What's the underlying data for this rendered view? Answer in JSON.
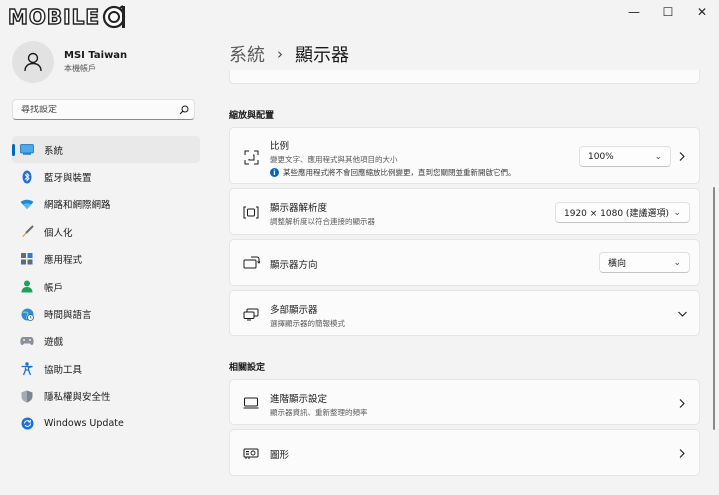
{
  "watermark": {
    "text": "MOBILE"
  },
  "window_controls": {
    "minimize": "—",
    "maximize": "☐",
    "close": "✕"
  },
  "profile": {
    "name": "MSI Taiwan",
    "subtitle": "本機帳戶"
  },
  "search": {
    "placeholder": "尋找設定"
  },
  "nav": {
    "items": [
      {
        "label": "系統",
        "icon": "system-icon",
        "active": true
      },
      {
        "label": "藍牙與裝置",
        "icon": "bluetooth-icon"
      },
      {
        "label": "網路和網際網路",
        "icon": "wifi-icon"
      },
      {
        "label": "個人化",
        "icon": "brush-icon"
      },
      {
        "label": "應用程式",
        "icon": "apps-icon"
      },
      {
        "label": "帳戶",
        "icon": "account-icon"
      },
      {
        "label": "時間與語言",
        "icon": "globe-clock-icon"
      },
      {
        "label": "遊戲",
        "icon": "gamepad-icon"
      },
      {
        "label": "協助工具",
        "icon": "accessibility-icon"
      },
      {
        "label": "隱私權與安全性",
        "icon": "shield-icon"
      },
      {
        "label": "Windows Update",
        "icon": "update-icon"
      }
    ]
  },
  "breadcrumb": {
    "parent": "系統",
    "separator": "›",
    "current": "顯示器"
  },
  "scale_layout": {
    "heading": "縮放與配置",
    "scale": {
      "title": "比例",
      "subtitle": "變更文字、應用程式與其他項目的大小",
      "note": "某些應用程式將不會回應縮放比例變更，直到您關閉並重新開啟它們。",
      "value": "100%"
    },
    "resolution": {
      "title": "顯示器解析度",
      "subtitle": "調整解析度以符合連接的顯示器",
      "value": "1920 × 1080 (建議選項)"
    },
    "orientation": {
      "title": "顯示器方向",
      "value": "橫向"
    },
    "multiple": {
      "title": "多部顯示器",
      "subtitle": "選擇顯示器的簡報模式"
    }
  },
  "related": {
    "heading": "相關設定",
    "advanced": {
      "title": "進階顯示設定",
      "subtitle": "顯示器資訊、重新整理的頻率"
    },
    "graphics": {
      "title": "圖形"
    }
  },
  "colors": {
    "accent": "#0067c0",
    "background": "#f3f3f3",
    "card": "#fbfbfb"
  }
}
